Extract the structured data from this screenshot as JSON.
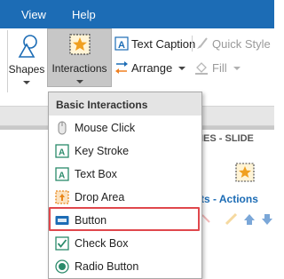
{
  "menubar": {
    "view": "View",
    "help": "Help",
    "bg_color": "#1c6cb5"
  },
  "ribbon": {
    "shapes_label": "Shapes",
    "interactions_label": "Interactions",
    "text_caption": "Text Caption",
    "quick_style": "Quick Style",
    "arrange": "Arrange",
    "fill": "Fill"
  },
  "background_panel": {
    "slide_label": "IES - SLIDE",
    "actions_label": "ts - Actions"
  },
  "dropdown": {
    "header": "Basic Interactions",
    "items": [
      {
        "label": "Mouse Click",
        "icon": "mouse-icon"
      },
      {
        "label": "Key Stroke",
        "icon": "key-stroke-icon"
      },
      {
        "label": "Text Box",
        "icon": "text-box-icon"
      },
      {
        "label": "Drop Area",
        "icon": "drop-area-icon"
      },
      {
        "label": "Button",
        "icon": "button-icon"
      },
      {
        "label": "Check Box",
        "icon": "check-box-icon"
      },
      {
        "label": "Radio Button",
        "icon": "radio-button-icon"
      }
    ],
    "highlighted_item": "Button",
    "highlight_color": "#e0474c"
  }
}
